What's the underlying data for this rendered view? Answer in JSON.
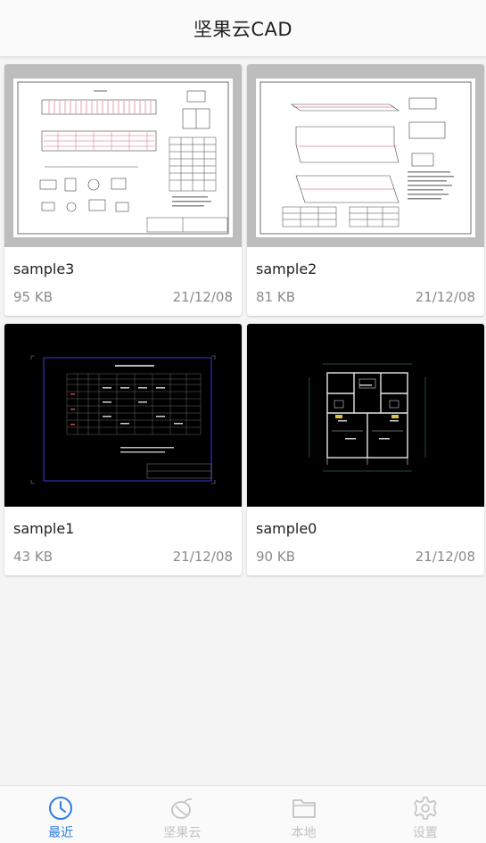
{
  "header": {
    "title": "坚果云CAD"
  },
  "files": [
    {
      "name": "sample3",
      "size": "95 KB",
      "date": "21/12/08",
      "thumb": "light-drawing-bridge"
    },
    {
      "name": "sample2",
      "size": "81 KB",
      "date": "21/12/08",
      "thumb": "light-drawing-slab"
    },
    {
      "name": "sample1",
      "size": "43 KB",
      "date": "21/12/08",
      "thumb": "dark-drawing-table"
    },
    {
      "name": "sample0",
      "size": "90 KB",
      "date": "21/12/08",
      "thumb": "dark-drawing-floorplan"
    }
  ],
  "tabs": [
    {
      "label": "最近",
      "icon": "clock-icon",
      "active": true
    },
    {
      "label": "坚果云",
      "icon": "nut-icon",
      "active": false
    },
    {
      "label": "本地",
      "icon": "folder-icon",
      "active": false
    },
    {
      "label": "设置",
      "icon": "gear-icon",
      "active": false
    }
  ],
  "colors": {
    "accent": "#2f7de1",
    "inactive": "#c2c2c2",
    "meta_text": "#8a8a8a"
  }
}
